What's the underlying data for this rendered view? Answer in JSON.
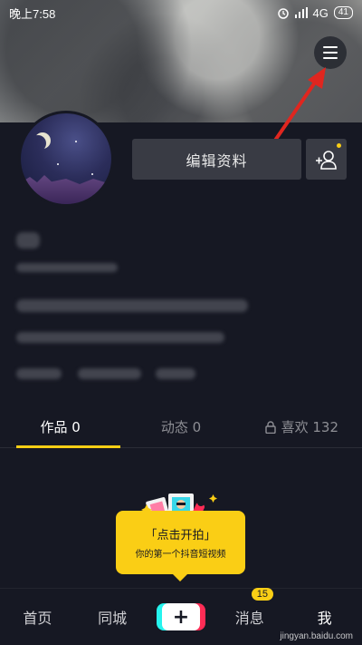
{
  "status_bar": {
    "time": "晚上7:58",
    "network": "4G",
    "battery": "41"
  },
  "profile": {
    "edit_button": "编辑资料"
  },
  "tabs": [
    {
      "label": "作品 0"
    },
    {
      "label": "动态 0"
    },
    {
      "label": "喜欢 132"
    }
  ],
  "empty_prompt": {
    "title": "「点击开拍」",
    "subtitle": "你的第一个抖音短视频"
  },
  "bottom_nav": {
    "home": "首页",
    "local": "同城",
    "plus": "+",
    "messages": "消息",
    "messages_badge": "15",
    "me": "我"
  },
  "watermark": "jingyan.baidu.com",
  "colors": {
    "accent": "#face15",
    "background": "#161823",
    "button": "#393b44",
    "arrow": "#e0261f"
  },
  "icons": [
    "menu-icon",
    "add-friend-icon",
    "lock-icon",
    "signal-icon",
    "alarm-icon"
  ]
}
